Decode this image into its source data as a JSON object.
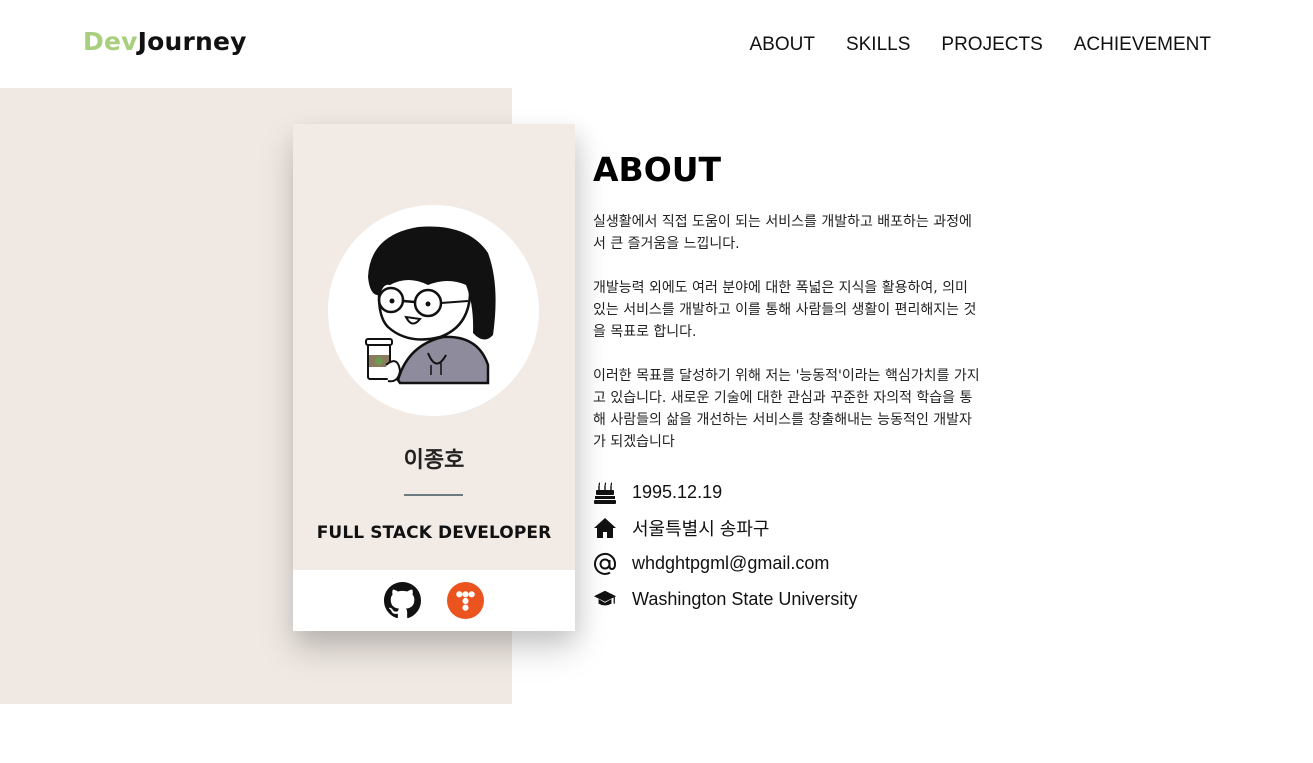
{
  "header": {
    "logo_prefix": "Dev",
    "logo_suffix": "Journey",
    "nav": [
      "ABOUT",
      "SKILLS",
      "PROJECTS",
      "ACHIEVEMENT"
    ]
  },
  "profile": {
    "name": "이종호",
    "role": "FULL STACK DEVELOPER",
    "social": [
      "github-icon",
      "tistory-icon"
    ]
  },
  "about": {
    "title": "ABOUT",
    "paragraphs": [
      "실생활에서 직접 도움이 되는 서비스를 개발하고 배포하는 과정에서 큰 즐거움을 느낍니다.",
      "개발능력 외에도 여러 분야에 대한 폭넓은 지식을 활용하여, 의미 있는 서비스를 개발하고 이를 통해 사람들의 생활이 편리해지는 것을 목표로 합니다.",
      "이러한 목표를 달성하기 위해 저는 '능동적'이라는 핵심가치를 가지고 있습니다. 새로운 기술에 대한 관심과 꾸준한 자의적 학습을 통해 사람들의 삶을 개선하는 서비스를 창출해내는 능동적인 개발자가 되겠습니다"
    ]
  },
  "info": [
    {
      "icon": "birthday-cake-icon",
      "text": "1995.12.19"
    },
    {
      "icon": "home-icon",
      "text": "서울특별시 송파구"
    },
    {
      "icon": "at-sign-icon",
      "text": "whdghtpgml@gmail.com"
    },
    {
      "icon": "graduation-cap-icon",
      "text": "Washington State University"
    }
  ],
  "colors": {
    "logo_accent": "#a8cf7e",
    "panel_bg": "#efe8e3",
    "tistory_orange": "#eb531f"
  }
}
